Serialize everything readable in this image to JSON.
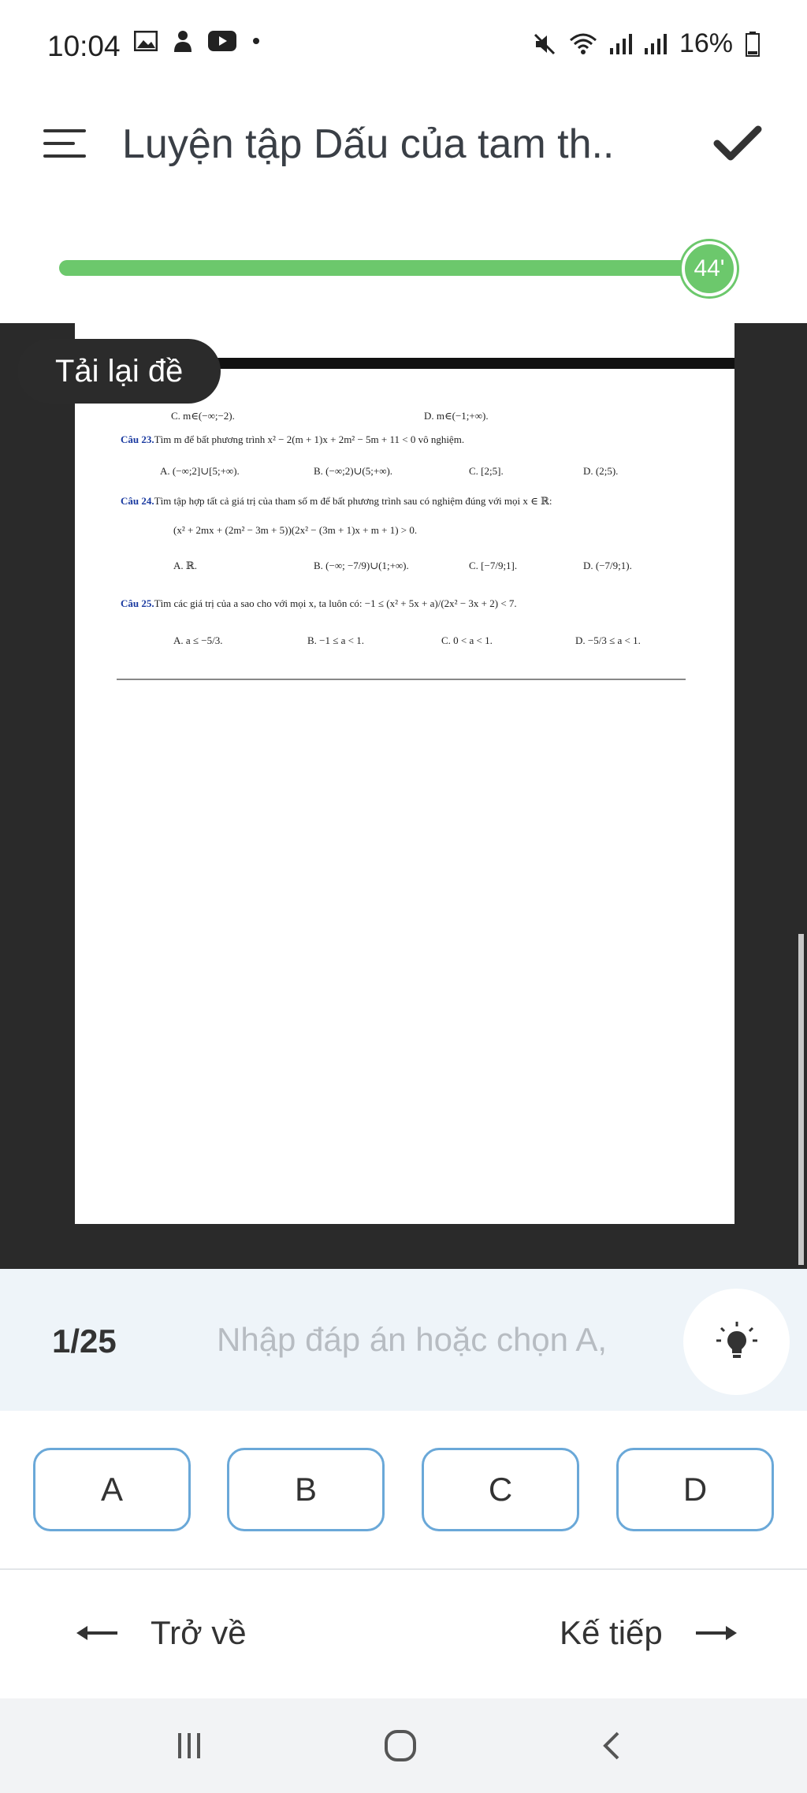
{
  "status_bar": {
    "time": "10:04",
    "battery": "16%",
    "left_icons": [
      "image-icon",
      "person-icon",
      "youtube-icon",
      "dot-icon"
    ],
    "right_icons": [
      "mute-icon",
      "wifi-icon",
      "signal-icon",
      "signal-icon",
      "battery-icon"
    ]
  },
  "header": {
    "title": "Luyện tập Dấu của tam th.."
  },
  "progress": {
    "fraction": 1.0,
    "timer": "44'"
  },
  "viewer": {
    "reload_label": "Tải lại đề"
  },
  "document": {
    "line1_c": "C. m∈(−∞;−2).",
    "line1_d": "D. m∈(−1;+∞).",
    "q23_label": "Câu 23.",
    "q23_text": "Tìm m để bất phương trình x² − 2(m + 1)x + 2m² − 5m + 11 < 0 vô nghiệm.",
    "q23_a": "A. (−∞;2]∪[5;+∞).",
    "q23_b": "B. (−∞;2)∪(5;+∞).",
    "q23_c": "C. [2;5].",
    "q23_d": "D. (2;5).",
    "q24_label": "Câu 24.",
    "q24_text": "Tìm tập hợp tất cả giá trị của tham số m để bất phương trình sau có nghiệm đúng với mọi x ∈ ℝ:",
    "q24_expr": "(x² + 2mx + (2m² − 3m + 5))(2x² − (3m + 1)x + m + 1) > 0.",
    "q24_a": "A. ℝ.",
    "q24_b": "B. (−∞; −7/9)∪(1;+∞).",
    "q24_c": "C. [−7/9;1].",
    "q24_d": "D. (−7/9;1).",
    "q25_label": "Câu 25.",
    "q25_text": "Tìm các giá trị của a sao cho với mọi x, ta luôn có: −1 ≤ (x² + 5x + a)/(2x² − 3x + 2) < 7.",
    "q25_a": "A. a ≤ −5/3.",
    "q25_b": "B. −1 ≤ a < 1.",
    "q25_c": "C. 0 < a < 1.",
    "q25_d": "D. −5/3 ≤ a < 1."
  },
  "answer_bar": {
    "counter": "1/25",
    "placeholder": "Nhập đáp án hoặc chọn A,"
  },
  "choices": [
    "A",
    "B",
    "C",
    "D"
  ],
  "nav": {
    "back_label": "Trở về",
    "next_label": "Kế tiếp"
  },
  "colors": {
    "progress_green": "#6cc86c",
    "choice_border": "#6aa8d8",
    "answer_bar_bg": "#eef4f9",
    "viewer_bg": "#2a2a2a"
  }
}
